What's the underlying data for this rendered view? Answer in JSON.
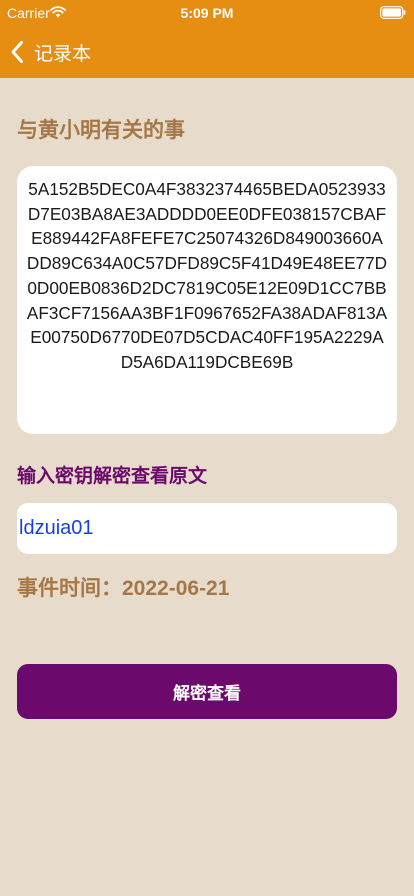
{
  "status_bar": {
    "carrier": "Carrier",
    "time": "5:09 PM",
    "wifi_icon": "wifi-icon",
    "battery_icon": "battery-icon"
  },
  "nav": {
    "back_icon": "chevron-left-icon",
    "back_label": "记录本"
  },
  "section_title": "与黄小明有关的事",
  "cipher_text": "5A152B5DEC0A4F3832374465BEDA0523933D7E03BA8AE3ADDDD0EE0DFE038157CBAFE889442FA8FEFE7C25074326D849003660ADD89C634A0C57DFD89C5F41D49E48EE77D0D00EB0836D2DC7819C05E12E09D1CC7BBAF3CF7156AA3BF1F0967652FA38ADAF813AE00750D6770DE07D5CDAC40FF195A2229AD5A6DA119DCBE69B",
  "key_label": "输入密钥解密查看原文",
  "key_value": "ldzuia01",
  "event_time_label": "事件时间：",
  "event_time_value": "2022-06-21",
  "decrypt_button_label": "解密查看",
  "colors": {
    "nav_background": "#e58e12",
    "page_background": "#e7dccb",
    "title_brown": "#a67746",
    "accent_purple": "#6b0a6c",
    "key_text_blue": "#1a3fe0"
  }
}
